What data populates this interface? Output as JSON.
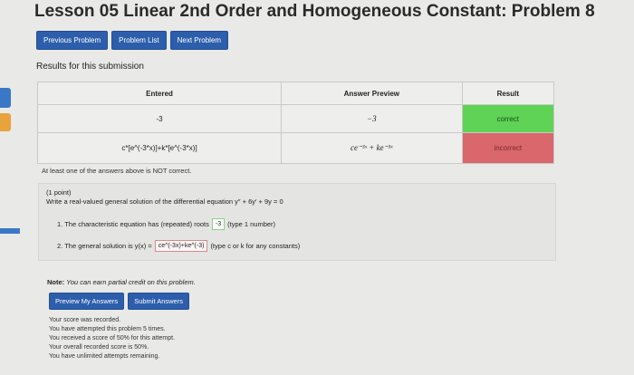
{
  "title": "Lesson 05 Linear 2nd Order and Homogeneous Constant: Problem 8",
  "nav": {
    "prev_label": "Previous Problem",
    "list_label": "Problem List",
    "next_label": "Next Problem"
  },
  "results_heading": "Results for this submission",
  "table": {
    "headers": [
      "Entered",
      "Answer Preview",
      "Result"
    ],
    "rows": [
      {
        "entered": "-3",
        "preview": "−3",
        "result": "correct"
      },
      {
        "entered": "c*[e^(-3*x)]+k*[e^(-3*x)]",
        "preview": "ce⁻³ˣ + ke⁻³ˣ",
        "result": "incorrect"
      }
    ]
  },
  "warning": "At least one of the answers above is NOT correct.",
  "problem": {
    "points": "(1 point)",
    "statement": "Write a real-valued general solution of the differential equation y″ + 6y′ + 9y = 0",
    "q1_label": "1. The characteristic equation has (repeated) roots",
    "q1_value": "-3",
    "q1_hint": "(type 1 number)",
    "q2_label": "2. The general solution is y(x) =",
    "q2_value": "ce^(-3x)+ke^(-3)",
    "q2_hint": "(type c or k for any constants)"
  },
  "note_label": "Note:",
  "note_text": "You can earn partial credit on this problem.",
  "buttons": {
    "preview_label": "Preview My Answers",
    "submit_label": "Submit Answers"
  },
  "status_lines": [
    "Your score was recorded.",
    "You have attempted this problem 5 times.",
    "You received a score of 50% for this attempt.",
    "Your overall recorded score is 50%.",
    "You have unlimited attempts remaining."
  ],
  "colors": {
    "correct": "#5ed356",
    "incorrect": "#d9676c",
    "button": "#2c5eab"
  }
}
